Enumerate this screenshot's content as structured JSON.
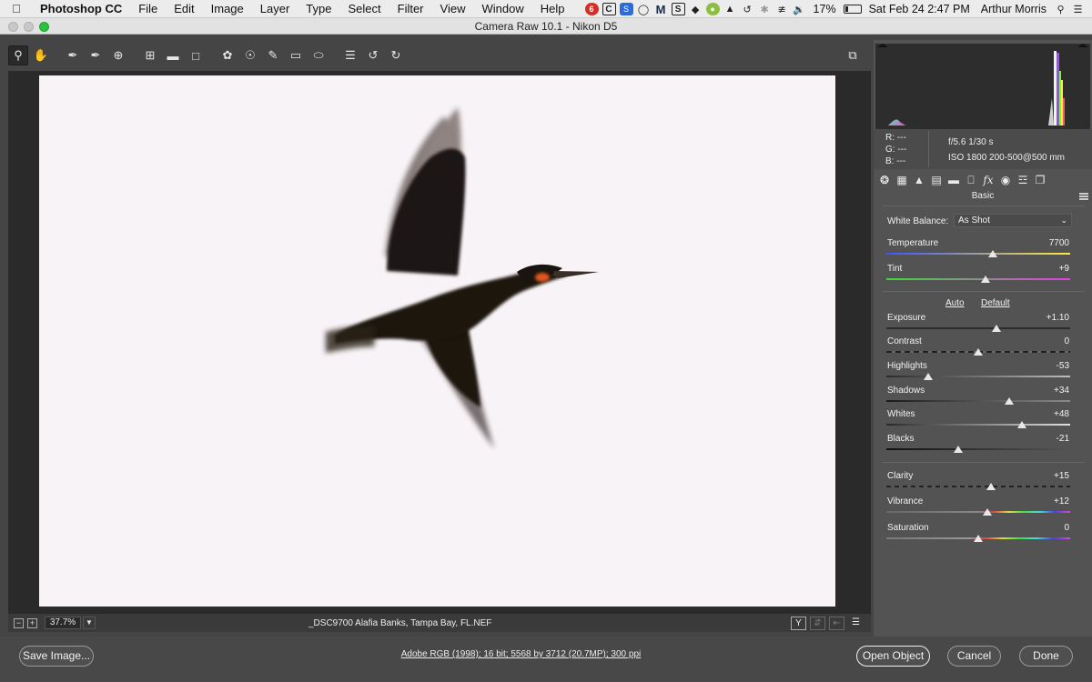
{
  "menubar": {
    "app": "Photoshop CC",
    "items": [
      "File",
      "Edit",
      "Image",
      "Layer",
      "Type",
      "Select",
      "Filter",
      "View",
      "Window",
      "Help"
    ],
    "battery": "17%",
    "datetime": "Sat Feb 24  2:47 PM",
    "user": "Arthur Morris"
  },
  "window": {
    "title": "Camera Raw 10.1  -  Nikon D5"
  },
  "toolbar": {
    "tools": [
      "zoom-tool-icon",
      "hand-tool-icon",
      "white-balance-tool-icon",
      "color-sampler-tool-icon",
      "targeted-adjustment-tool-icon",
      "crop-tool-icon",
      "straighten-tool-icon",
      "transform-tool-icon",
      "spot-removal-tool-icon",
      "red-eye-removal-tool-icon",
      "adjustment-brush-icon",
      "graduated-filter-icon",
      "radial-filter-icon",
      "preferences-icon",
      "rotate-ccw-icon",
      "rotate-cw-icon"
    ]
  },
  "status": {
    "zoom": "37.7%",
    "filename": "_DSC9700  Alafia Banks, Tampa Bay, FL.NEF"
  },
  "info": {
    "r": "R:   ---",
    "g": "G:   ---",
    "b": "B:   ---",
    "aperture_shutter": "f/5.6   1/30 s",
    "iso_lens": "ISO 1800   200-500@500 mm"
  },
  "panel": {
    "title": "Basic",
    "white_balance_label": "White Balance:",
    "white_balance_value": "As Shot",
    "auto": "Auto",
    "default": "Default",
    "sliders": {
      "temperature": {
        "label": "Temperature",
        "value": "7700",
        "level": 0.58
      },
      "tint": {
        "label": "Tint",
        "value": "+9",
        "level": 0.54
      },
      "exposure": {
        "label": "Exposure",
        "value": "+1.10",
        "level": 0.6
      },
      "contrast": {
        "label": "Contrast",
        "value": "0",
        "level": 0.5
      },
      "highlights": {
        "label": "Highlights",
        "value": "-53",
        "level": 0.23
      },
      "shadows": {
        "label": "Shadows",
        "value": "+34",
        "level": 0.67
      },
      "whites": {
        "label": "Whites",
        "value": "+48",
        "level": 0.74
      },
      "blacks": {
        "label": "Blacks",
        "value": "-21",
        "level": 0.39
      },
      "clarity": {
        "label": "Clarity",
        "value": "+15",
        "level": 0.57
      },
      "vibrance": {
        "label": "Vibrance",
        "value": "+12",
        "level": 0.55
      },
      "saturation": {
        "label": "Saturation",
        "value": "0",
        "level": 0.5
      }
    }
  },
  "bottom": {
    "save": "Save Image...",
    "workflow": "Adobe RGB (1998); 16 bit; 5568 by 3712 (20.7MP); 300 ppi",
    "open": "Open Object",
    "cancel": "Cancel",
    "done": "Done"
  }
}
